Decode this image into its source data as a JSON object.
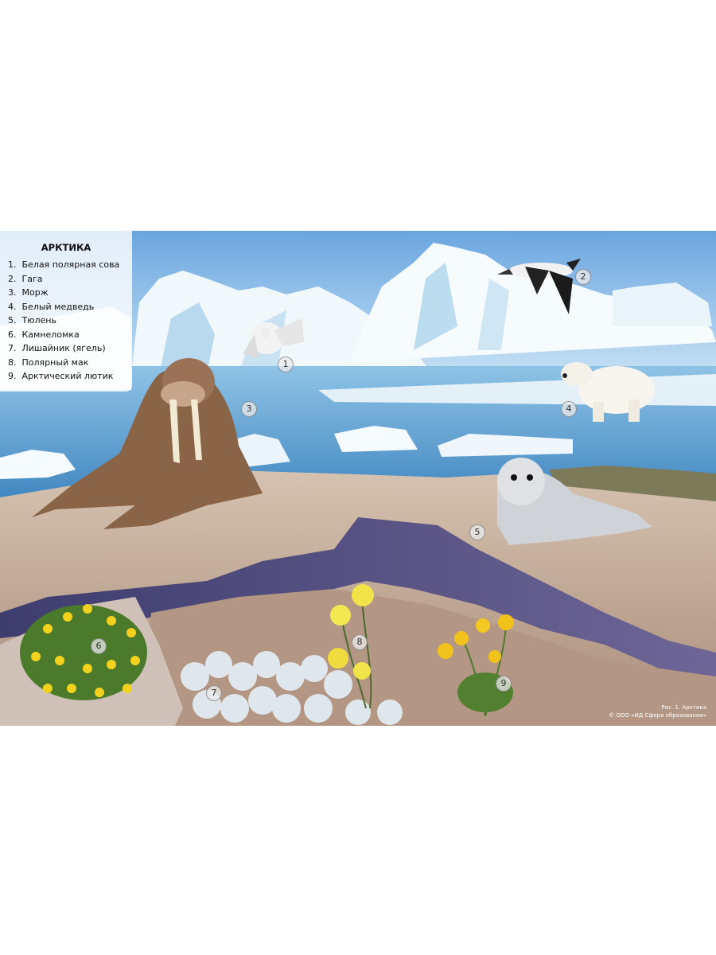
{
  "legend": {
    "title": "АРКТИКА",
    "items": [
      {
        "num": "1.",
        "label": "Белая полярная сова"
      },
      {
        "num": "2.",
        "label": "Гага"
      },
      {
        "num": "3.",
        "label": "Морж"
      },
      {
        "num": "4.",
        "label": "Белый медведь"
      },
      {
        "num": "5.",
        "label": "Тюлень"
      },
      {
        "num": "6.",
        "label": "Камнеломка"
      },
      {
        "num": "7.",
        "label": "Лишайник (ягель)"
      },
      {
        "num": "8.",
        "label": "Полярный мак"
      },
      {
        "num": "9.",
        "label": "Арктический лютик"
      }
    ]
  },
  "markers": [
    "1",
    "2",
    "3",
    "4",
    "5",
    "6",
    "7",
    "8",
    "9"
  ],
  "caption": {
    "line1": "Рис. 1. Арктика",
    "line2": "© ООО «ИД Сфера образования»"
  },
  "colors": {
    "sky": "#7fb6e6",
    "ice": "#eef6fb",
    "water": "#6aa9d6",
    "rock": "#c9b4a2",
    "pond": "#5f5a86",
    "walrus": "#8a6447"
  }
}
